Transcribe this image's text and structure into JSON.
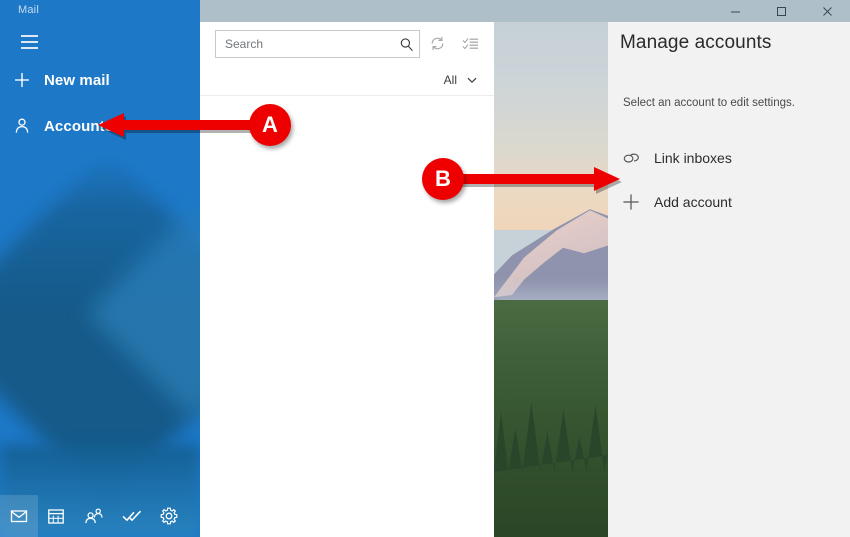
{
  "window": {
    "app_name": "Mail",
    "controls": [
      {
        "name": "minimize",
        "glyph": "minimize-icon"
      },
      {
        "name": "maximize",
        "glyph": "maximize-icon"
      },
      {
        "name": "close",
        "glyph": "close-icon"
      }
    ],
    "titlebar_color": "#aebfc9"
  },
  "sidebar": {
    "title": "Mail",
    "accent_color": "#1d78c7",
    "hamburger_name": "hamburger-menu-icon",
    "items": [
      {
        "label": "New mail",
        "icon": "plus-icon"
      },
      {
        "label": "Accounts",
        "icon": "person-icon"
      }
    ],
    "bottom_bar": [
      {
        "name": "mail-icon",
        "selected": true
      },
      {
        "name": "calendar-icon",
        "selected": false
      },
      {
        "name": "people-icon",
        "selected": false
      },
      {
        "name": "todo-icon",
        "selected": false
      },
      {
        "name": "settings-gear-icon",
        "selected": false
      }
    ]
  },
  "message_list": {
    "search": {
      "value": "",
      "placeholder": "Search",
      "icon": "search-icon"
    },
    "toolbar": [
      {
        "name": "sync-icon",
        "label": "Sync this view"
      },
      {
        "name": "selection-mode-icon",
        "label": "Enter selection mode"
      }
    ],
    "filter": {
      "label": "All",
      "chevron": "chevron-down-icon"
    }
  },
  "panel": {
    "title": "Manage accounts",
    "subtitle": "Select an account to edit settings.",
    "background_color": "#f2f2f2",
    "rows": [
      {
        "label": "Link inboxes",
        "icon": "link-inboxes-icon"
      },
      {
        "label": "Add account",
        "icon": "plus-icon"
      }
    ]
  },
  "annotations": {
    "color": "#ee0000",
    "markers": [
      {
        "label": "A",
        "points_to": "Accounts",
        "direction": "left"
      },
      {
        "label": "B",
        "points_to": "Add account",
        "direction": "right"
      }
    ]
  }
}
